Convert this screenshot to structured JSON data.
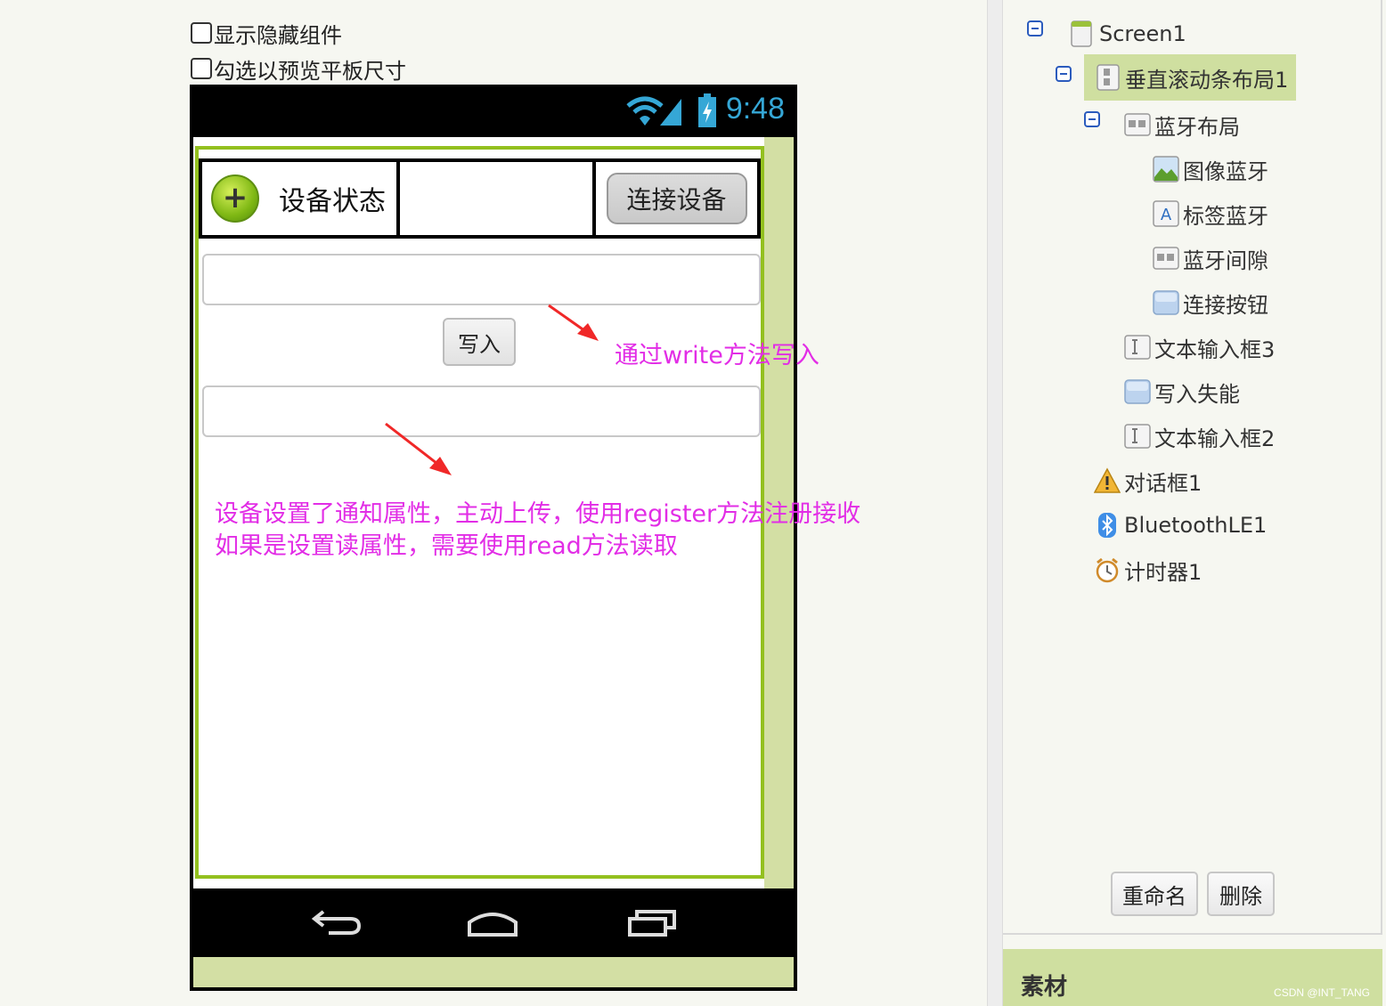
{
  "options": {
    "show_hidden": "显示隐藏组件",
    "tablet_preview": "勾选以预览平板尺寸"
  },
  "phone": {
    "status_time": "9:48",
    "bluetooth_status_label": "设备状态",
    "connect_button": "连接设备",
    "write_button": "写入",
    "nav_icons": [
      "back-icon",
      "home-icon",
      "recent-apps-icon"
    ]
  },
  "annotations": {
    "write_note": "通过write方法写入",
    "notify_note_line1": "设备设置了通知属性，主动上传，使用register方法注册接收",
    "notify_note_line2": "如果是设置读属性，需要使用read方法读取",
    "color": "#e22de6"
  },
  "components_tree": {
    "nodes": [
      {
        "label": "Screen1",
        "icon": "screen-icon"
      },
      {
        "label": "垂直滚动条布局1",
        "icon": "vertical-scroll-layout-icon",
        "selected": true
      },
      {
        "label": "蓝牙布局",
        "icon": "horizontal-layout-icon"
      },
      {
        "label": "图像蓝牙",
        "icon": "image-icon"
      },
      {
        "label": "标签蓝牙",
        "icon": "label-icon"
      },
      {
        "label": "蓝牙间隙",
        "icon": "horizontal-layout-icon"
      },
      {
        "label": "连接按钮",
        "icon": "button-icon"
      },
      {
        "label": "文本输入框3",
        "icon": "textbox-icon"
      },
      {
        "label": "写入失能",
        "icon": "button-icon"
      },
      {
        "label": "文本输入框2",
        "icon": "textbox-icon"
      },
      {
        "label": "对话框1",
        "icon": "notifier-warning-icon"
      },
      {
        "label": "BluetoothLE1",
        "icon": "bluetooth-icon"
      },
      {
        "label": "计时器1",
        "icon": "clock-icon"
      }
    ],
    "rename_button": "重命名",
    "delete_button": "删除"
  },
  "media_panel": {
    "title": "素材",
    "watermark": "CSDN @INT_TANG"
  },
  "colors": {
    "selection": "#cfdfa0",
    "layout_border": "#93c01f",
    "status_blue": "#35a7d6"
  }
}
